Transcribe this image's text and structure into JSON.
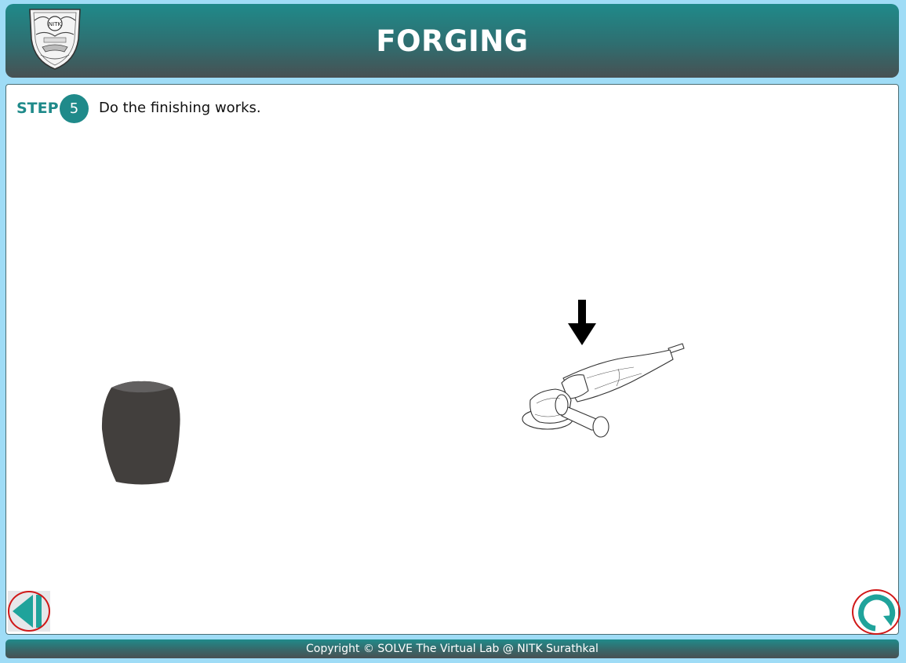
{
  "header": {
    "title": "FORGING",
    "logo_icon": "nitk-crest-logo"
  },
  "step": {
    "label": "STEP",
    "number": "5",
    "instruction": "Do the finishing works."
  },
  "scene": {
    "workpiece": "forged-workpiece",
    "tool": "angle-grinder-icon",
    "indicator": "down-arrow-icon"
  },
  "navigation": {
    "back_icon": "previous-step-icon",
    "restart_icon": "restart-icon",
    "accent_color": "#1fa39b",
    "highlight_color": "#d01818"
  },
  "footer": {
    "copyright": "Copyright © SOLVE The Virtual Lab @ NITK Surathkal"
  },
  "colors": {
    "teal": "#1f8a8a",
    "background": "#9fdcf6",
    "workpiece": "#423f3d"
  }
}
